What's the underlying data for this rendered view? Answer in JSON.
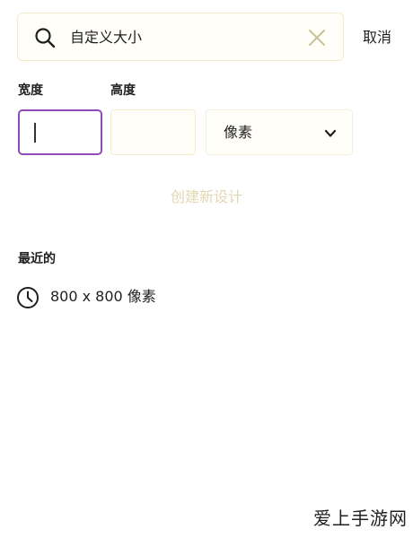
{
  "search": {
    "value": "自定义大小",
    "cancel_label": "取消"
  },
  "dimensions": {
    "width_label": "宽度",
    "height_label": "高度",
    "width_value": "",
    "height_value": "",
    "unit": "像素"
  },
  "create_button": {
    "label": "创建新设计",
    "enabled": false
  },
  "recent": {
    "title": "最近的",
    "items": [
      {
        "label": "800 x 800 像素",
        "icon": "clock-icon"
      }
    ]
  },
  "watermark": {
    "text": "爱上手游网"
  },
  "colors": {
    "accent_border": "#8f4bb8",
    "disabled_text": "#e2d6b3",
    "field_border": "#f2eccc"
  }
}
